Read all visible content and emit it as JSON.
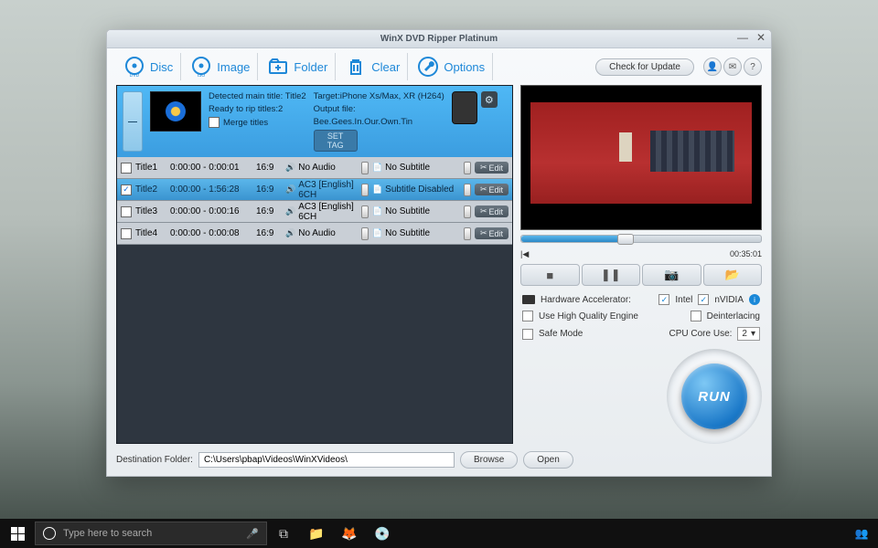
{
  "window": {
    "title": "WinX DVD Ripper Platinum",
    "minimize": "—",
    "close": "✕"
  },
  "toolbar": {
    "disc": "Disc",
    "image": "Image",
    "folder": "Folder",
    "clear": "Clear",
    "options": "Options",
    "check_update": "Check for Update"
  },
  "summary": {
    "detected_main_title": "Detected main title: Title2",
    "ready": "Ready to rip titles:2",
    "merge": "Merge titles",
    "target": "Target:iPhone Xs/Max, XR (H264)",
    "output_label": "Output file:",
    "output_file": "Bee.Gees.In.Our.Own.Tin",
    "set_tag": "SET TAG"
  },
  "titles": [
    {
      "checked": false,
      "name": "Title1",
      "range": "0:00:00 - 0:00:01",
      "ar": "16:9",
      "audio": "No Audio",
      "sub": "No Subtitle",
      "edit": "Edit"
    },
    {
      "checked": true,
      "name": "Title2",
      "range": "0:00:00 - 1:56:28",
      "ar": "16:9",
      "audio": "AC3  [English]  6CH",
      "sub": "Subtitle Disabled",
      "edit": "Edit"
    },
    {
      "checked": false,
      "name": "Title3",
      "range": "0:00:00 - 0:00:16",
      "ar": "16:9",
      "audio": "AC3  [English]  6CH",
      "sub": "No Subtitle",
      "edit": "Edit"
    },
    {
      "checked": false,
      "name": "Title4",
      "range": "0:00:00 - 0:00:08",
      "ar": "16:9",
      "audio": "No Audio",
      "sub": "No Subtitle",
      "edit": "Edit"
    }
  ],
  "preview": {
    "start": "|◀",
    "time": "00:35:01"
  },
  "options": {
    "hw_label": "Hardware Accelerator:",
    "intel": "Intel",
    "nvidia": "nVIDIA",
    "hq": "Use High Quality Engine",
    "deint": "Deinterlacing",
    "safe": "Safe Mode",
    "cpu_label": "CPU Core Use:",
    "cpu_value": "2"
  },
  "run": "RUN",
  "dest": {
    "label": "Destination Folder:",
    "value": "C:\\Users\\pbap\\Videos\\WinXVideos\\",
    "browse": "Browse",
    "open": "Open"
  },
  "taskbar": {
    "search_placeholder": "Type here to search"
  }
}
